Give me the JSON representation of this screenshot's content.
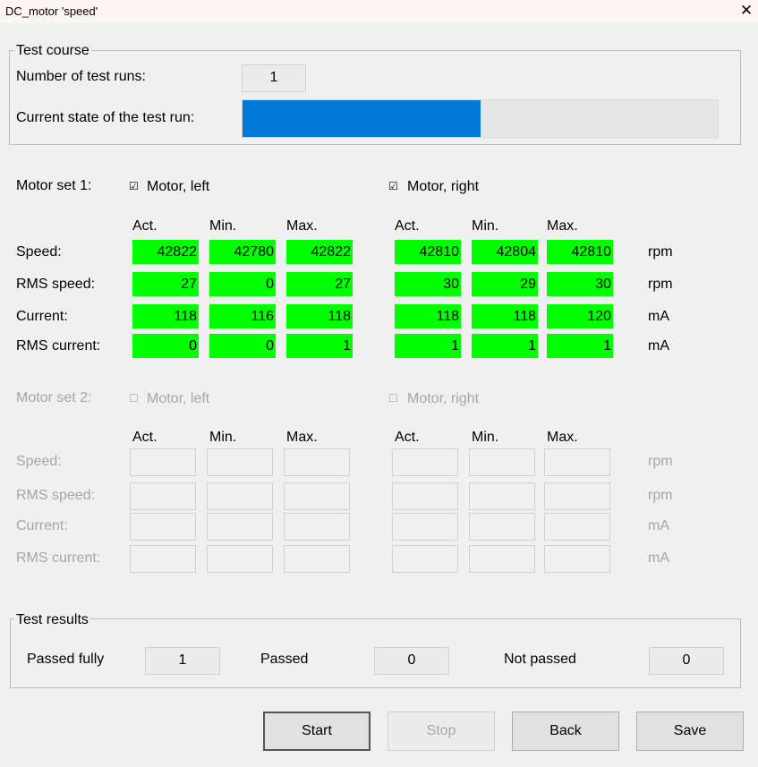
{
  "window": {
    "title": "DC_motor 'speed'",
    "close_glyph": "✕"
  },
  "test_course": {
    "legend": "Test course",
    "runs_label": "Number of test runs:",
    "runs_value": "1",
    "state_label": "Current state of the test run:",
    "progress_fraction": 0.5
  },
  "motor_set_1": {
    "label": "Motor set 1:",
    "left_check": "☑",
    "left_label": "Motor, left",
    "right_check": "☑",
    "right_label": "Motor, right",
    "col_headers": [
      "Act.",
      "Min.",
      "Max."
    ],
    "rows": [
      {
        "label": "Speed:",
        "left": [
          "42822",
          "42780",
          "42822"
        ],
        "right": [
          "42810",
          "42804",
          "42810"
        ],
        "unit": "rpm"
      },
      {
        "label": "RMS speed:",
        "left": [
          "27",
          "0",
          "27"
        ],
        "right": [
          "30",
          "29",
          "30"
        ],
        "unit": "rpm"
      },
      {
        "label": "Current:",
        "left": [
          "118",
          "116",
          "118"
        ],
        "right": [
          "118",
          "118",
          "120"
        ],
        "unit": "mA"
      },
      {
        "label": "RMS current:",
        "left": [
          "0",
          "0",
          "1"
        ],
        "right": [
          "1",
          "1",
          "1"
        ],
        "unit": "mA"
      }
    ]
  },
  "motor_set_2": {
    "label": "Motor set 2:",
    "left_check": "☐",
    "left_label": "Motor, left",
    "right_check": "☐",
    "right_label": "Motor, right",
    "col_headers": [
      "Act.",
      "Min.",
      "Max."
    ],
    "rows": [
      {
        "label": "Speed:",
        "unit": "rpm"
      },
      {
        "label": "RMS speed:",
        "unit": "rpm"
      },
      {
        "label": "Current:",
        "unit": "mA"
      },
      {
        "label": "RMS current:",
        "unit": "mA"
      }
    ]
  },
  "test_results": {
    "legend": "Test results",
    "passed_fully_label": "Passed fully",
    "passed_fully_value": "1",
    "passed_label": "Passed",
    "passed_value": "0",
    "not_passed_label": "Not passed",
    "not_passed_value": "0"
  },
  "buttons": {
    "start": "Start",
    "stop": "Stop",
    "back": "Back",
    "save": "Save"
  },
  "colors": {
    "ok": "#00ff00",
    "progress": "#0078d7",
    "disabled_text": "#a6a6a6"
  }
}
